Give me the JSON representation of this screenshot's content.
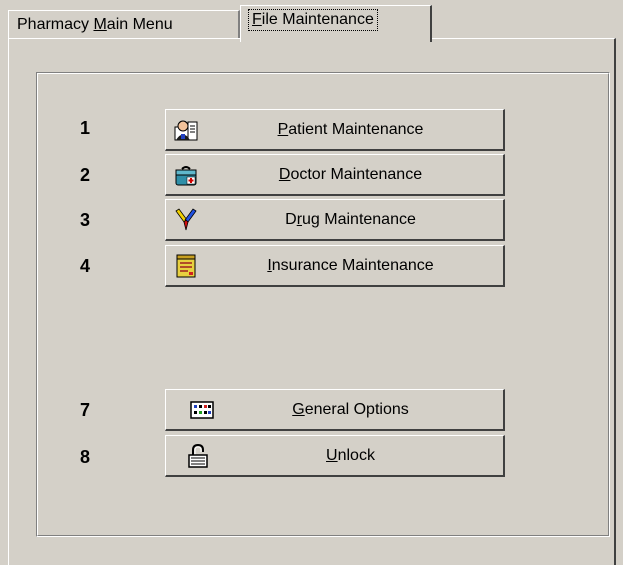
{
  "tabs": [
    {
      "label_pre": "Pharmacy ",
      "label_ul": "M",
      "label_post": "ain Menu"
    },
    {
      "label_pre": "",
      "label_ul": "F",
      "label_post": "ile Maintenance"
    }
  ],
  "menu": [
    {
      "number": "1",
      "icon": "patient-icon",
      "label_pre": "",
      "label_ul": "P",
      "label_post": "atient Maintenance"
    },
    {
      "number": "2",
      "icon": "doctor-bag-icon",
      "label_pre": "",
      "label_ul": "D",
      "label_post": "octor Maintenance"
    },
    {
      "number": "3",
      "icon": "drug-icon",
      "label_pre": "D",
      "label_ul": "r",
      "label_post": "ug Maintenance"
    },
    {
      "number": "4",
      "icon": "insurance-icon",
      "label_pre": "",
      "label_ul": "I",
      "label_post": "nsurance Maintenance"
    },
    {
      "number": "7",
      "icon": "options-icon",
      "label_pre": "",
      "label_ul": "G",
      "label_post": "eneral Options"
    },
    {
      "number": "8",
      "icon": "padlock-icon",
      "label_pre": "",
      "label_ul": "U",
      "label_post": "nlock"
    }
  ]
}
